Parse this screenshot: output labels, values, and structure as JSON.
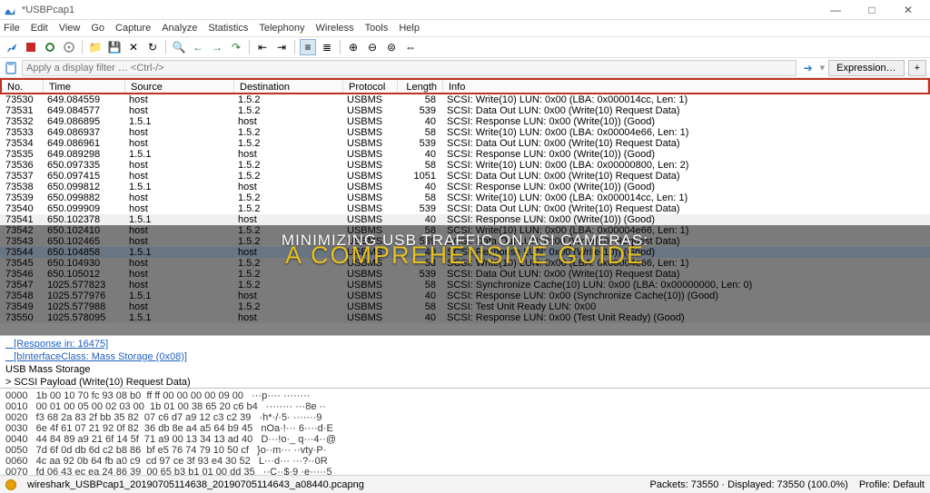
{
  "window": {
    "title": "*USBPcap1",
    "min": "—",
    "max": "□",
    "close": "✕"
  },
  "menu": [
    "File",
    "Edit",
    "View",
    "Go",
    "Capture",
    "Analyze",
    "Statistics",
    "Telephony",
    "Wireless",
    "Tools",
    "Help"
  ],
  "filter": {
    "placeholder": "Apply a display filter … <Ctrl-/>",
    "expression": "Expression…",
    "plus": "+"
  },
  "columns": {
    "no": "No.",
    "time": "Time",
    "src": "Source",
    "dst": "Destination",
    "proto": "Protocol",
    "len": "Length",
    "info": "Info"
  },
  "rows": [
    {
      "no": "73530",
      "time": "649.084559",
      "src": "host",
      "dst": "1.5.2",
      "proto": "USBMS",
      "len": "58",
      "info": "SCSI: Write(10) LUN: 0x00 (LBA: 0x000014cc, Len: 1)"
    },
    {
      "no": "73531",
      "time": "649.084577",
      "src": "host",
      "dst": "1.5.2",
      "proto": "USBMS",
      "len": "539",
      "info": "SCSI: Data Out LUN: 0x00 (Write(10) Request Data)"
    },
    {
      "no": "73532",
      "time": "649.086895",
      "src": "1.5.1",
      "dst": "host",
      "proto": "USBMS",
      "len": "40",
      "info": "SCSI: Response LUN: 0x00 (Write(10)) (Good)"
    },
    {
      "no": "73533",
      "time": "649.086937",
      "src": "host",
      "dst": "1.5.2",
      "proto": "USBMS",
      "len": "58",
      "info": "SCSI: Write(10) LUN: 0x00 (LBA: 0x00004e66, Len: 1)"
    },
    {
      "no": "73534",
      "time": "649.086961",
      "src": "host",
      "dst": "1.5.2",
      "proto": "USBMS",
      "len": "539",
      "info": "SCSI: Data Out LUN: 0x00 (Write(10) Request Data)"
    },
    {
      "no": "73535",
      "time": "649.089298",
      "src": "1.5.1",
      "dst": "host",
      "proto": "USBMS",
      "len": "40",
      "info": "SCSI: Response LUN: 0x00 (Write(10)) (Good)"
    },
    {
      "no": "73536",
      "time": "650.097335",
      "src": "host",
      "dst": "1.5.2",
      "proto": "USBMS",
      "len": "58",
      "info": "SCSI: Write(10) LUN: 0x00 (LBA: 0x00000800, Len: 2)"
    },
    {
      "no": "73537",
      "time": "650.097415",
      "src": "host",
      "dst": "1.5.2",
      "proto": "USBMS",
      "len": "1051",
      "info": "SCSI: Data Out LUN: 0x00 (Write(10) Request Data)"
    },
    {
      "no": "73538",
      "time": "650.099812",
      "src": "1.5.1",
      "dst": "host",
      "proto": "USBMS",
      "len": "40",
      "info": "SCSI: Response LUN: 0x00 (Write(10)) (Good)"
    },
    {
      "no": "73539",
      "time": "650.099882",
      "src": "host",
      "dst": "1.5.2",
      "proto": "USBMS",
      "len": "58",
      "info": "SCSI: Write(10) LUN: 0x00 (LBA: 0x000014cc, Len: 1)"
    },
    {
      "no": "73540",
      "time": "650.099909",
      "src": "host",
      "dst": "1.5.2",
      "proto": "USBMS",
      "len": "539",
      "info": "SCSI: Data Out LUN: 0x00 (Write(10) Request Data)"
    },
    {
      "no": "73541",
      "time": "650.102378",
      "src": "1.5.1",
      "dst": "host",
      "proto": "USBMS",
      "len": "40",
      "info": "SCSI: Response LUN: 0x00 (Write(10)) (Good)",
      "shade": true
    },
    {
      "no": "73542",
      "time": "650.102410",
      "src": "host",
      "dst": "1.5.2",
      "proto": "USBMS",
      "len": "58",
      "info": "SCSI: Write(10) LUN: 0x00 (LBA: 0x00004e66, Len: 1)",
      "shade": true
    },
    {
      "no": "73543",
      "time": "650.102465",
      "src": "host",
      "dst": "1.5.2",
      "proto": "USBMS",
      "len": "539",
      "info": "SCSI: Data Out LUN: 0x00 (Write(10) Request Data)",
      "shade": true
    },
    {
      "no": "73544",
      "time": "650.104858",
      "src": "1.5.1",
      "dst": "host",
      "proto": "USBMS",
      "len": "40",
      "info": "SCSI: Response LUN: 0x00 (Write(10)) (Good)",
      "shade": true,
      "sel": true
    },
    {
      "no": "73545",
      "time": "650.104930",
      "src": "host",
      "dst": "1.5.2",
      "proto": "USBMS",
      "len": "58",
      "info": "SCSI: Write(10) LUN: 0x00 (LBA: 0x00004e66, Len: 1)",
      "shade": true
    },
    {
      "no": "73546",
      "time": "650.105012",
      "src": "host",
      "dst": "1.5.2",
      "proto": "USBMS",
      "len": "539",
      "info": "SCSI: Data Out LUN: 0x00 (Write(10) Request Data)",
      "shade": true
    },
    {
      "no": "73547",
      "time": "1025.577823",
      "src": "host",
      "dst": "1.5.2",
      "proto": "USBMS",
      "len": "58",
      "info": "SCSI: Synchronize Cache(10) LUN: 0x00 (LBA: 0x00000000, Len: 0)",
      "shade": true
    },
    {
      "no": "73548",
      "time": "1025.577976",
      "src": "1.5.1",
      "dst": "host",
      "proto": "USBMS",
      "len": "40",
      "info": "SCSI: Response LUN: 0x00 (Synchronize Cache(10)) (Good)",
      "shade": true
    },
    {
      "no": "73549",
      "time": "1025.577988",
      "src": "host",
      "dst": "1.5.2",
      "proto": "USBMS",
      "len": "58",
      "info": "SCSI: Test Unit Ready LUN: 0x00",
      "shade": true
    },
    {
      "no": "73550",
      "time": "1025.578095",
      "src": "1.5.1",
      "dst": "host",
      "proto": "USBMS",
      "len": "40",
      "info": "SCSI: Response LUN: 0x00 (Test Unit Ready) (Good)",
      "shade": true
    }
  ],
  "overlay": {
    "line1": "MINIMIZING USB TRAFFIC ON ASI CAMERAS:",
    "line2": "A COMPREHENSIVE GUIDE"
  },
  "details": {
    "l1": "   [Response in: 16475]",
    "l2": "   [bInterfaceClass: Mass Storage (0x08)]",
    "l3": "USB Mass Storage",
    "l4": "> SCSI Payload (Write(10) Request Data)"
  },
  "hex": [
    "0000   1b 00 10 70 fc 93 08 b0  ff ff 00 00 00 00 09 00   ···p···· ········",
    "0010   00 01 00 05 00 02 03 00  1b 01 00 38 65 20 c6 b4   ········ ···8e ··",
    "0020   f3 68 2a 83 2f bb 35 82  07 c6 d7 a9 12 c3 c2 39   ·h*·/·5· ·······9",
    "0030   6e 4f 61 07 21 92 0f 82  36 db 8e a4 a5 64 b9 45   nOa·!··· 6····d·E",
    "0040   44 84 89 a9 21 6f 14 5f  71 a9 00 13 34 13 ad 40   D···!o·_ q···4··@",
    "0050   7d 6f 0d db 6d c2 b8 86  bf e5 76 74 79 10 50 cf   }o··m··· ··vty·P·",
    "0060   4c aa 92 0b 64 fb a0 c9  cd 97 ce 3f 93 e4 30 52   L···d··· ···?··0R",
    "0070   fd 06 43 ec ea 24 86 39  00 65 b3 b1 01 00 dd 35   ··C··$·9 ·e·····5"
  ],
  "status": {
    "file": "wireshark_USBPcap1_20190705114638_20190705114643_a08440.pcapng",
    "packets": "Packets: 73550 · Displayed: 73550 (100.0%)",
    "profile": "Profile: Default"
  }
}
